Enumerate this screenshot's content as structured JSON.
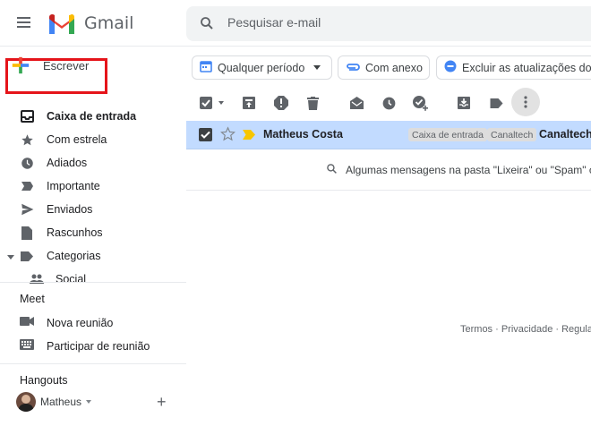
{
  "header": {
    "app_name": "Gmail",
    "search_placeholder": "Pesquisar e-mail"
  },
  "compose": {
    "label": "Escrever",
    "highlight_color": "#e5141a"
  },
  "sidebar": {
    "items": [
      {
        "label": "Caixa de entrada",
        "icon": "inbox-icon",
        "active": true
      },
      {
        "label": "Com estrela",
        "icon": "star-icon"
      },
      {
        "label": "Adiados",
        "icon": "clock-icon"
      },
      {
        "label": "Importante",
        "icon": "important-icon"
      },
      {
        "label": "Enviados",
        "icon": "send-icon"
      },
      {
        "label": "Rascunhos",
        "icon": "draft-icon"
      },
      {
        "label": "Categorias",
        "icon": "label-icon"
      },
      {
        "label": "Social",
        "icon": "people-icon"
      }
    ],
    "meet": {
      "title": "Meet",
      "items": [
        {
          "label": "Nova reunião",
          "icon": "video-icon"
        },
        {
          "label": "Participar de reunião",
          "icon": "keyboard-icon"
        }
      ]
    },
    "hangouts": {
      "title": "Hangouts",
      "user": "Matheus"
    }
  },
  "filters": [
    {
      "label": "Qualquer período",
      "icon": "calendar-icon"
    },
    {
      "label": "Com anexo",
      "icon": "attachment-icon"
    },
    {
      "label": "Excluir as atualizações do",
      "icon": "minus-circle-icon"
    }
  ],
  "email": {
    "sender": "Matheus Costa",
    "labels": [
      "Caixa de entrada",
      "Canaltech"
    ],
    "subject": "Canaltech -",
    "selected": true
  },
  "info_text": "Algumas mensagens na pasta \"Lixeira\" ou \"Spam\" corre",
  "footer": [
    "Termos",
    "Privacidade",
    "Regulame"
  ],
  "colors": {
    "selected_row": "#c2dbff",
    "more_button_bg": "#e2e2e2",
    "compose_plus_blue": "#4285f4"
  }
}
